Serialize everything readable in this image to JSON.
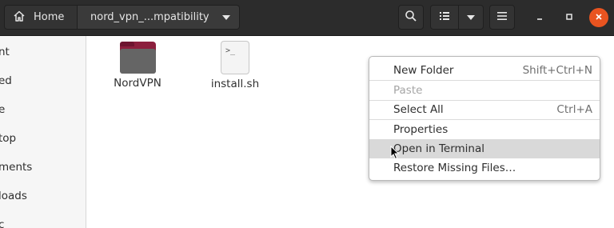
{
  "header": {
    "pathbar": {
      "home_label": "Home",
      "current_label": "nord_vpn_...mpatibility"
    },
    "icons": [
      "home-icon",
      "chevron-down-icon",
      "search-icon",
      "list-view-icon",
      "view-options-icon",
      "hamburger-menu-icon",
      "minimize-icon",
      "maximize-icon",
      "close-icon"
    ]
  },
  "sidebar": {
    "items": [
      {
        "label": "nt"
      },
      {
        "label": "ed"
      },
      {
        "label": "e"
      },
      {
        "label": "top"
      },
      {
        "label": "ments"
      },
      {
        "label": "loads"
      },
      {
        "label": "c"
      }
    ]
  },
  "files": [
    {
      "name": "NordVPN",
      "icon": "folder-icon"
    },
    {
      "name": "install.sh",
      "icon": "script-file-icon",
      "glyph": ">_"
    }
  ],
  "context_menu": {
    "items": [
      {
        "label": "New Folder",
        "accel": "Shift+Ctrl+N",
        "enabled": true
      },
      {
        "label": "Paste",
        "accel": "",
        "enabled": false
      },
      {
        "label": "Select All",
        "accel": "Ctrl+A",
        "enabled": true
      },
      {
        "label": "Properties",
        "accel": "",
        "enabled": true
      },
      {
        "label": "Open in Terminal",
        "accel": "",
        "enabled": true,
        "highlighted": true
      },
      {
        "label": "Restore Missing Files…",
        "accel": "",
        "enabled": true
      }
    ]
  },
  "colors": {
    "header_bg": "#2c2c2c",
    "close_button": "#e95420",
    "folder_accent": "#8c1f3d",
    "menu_highlight": "#d9d9d9"
  }
}
